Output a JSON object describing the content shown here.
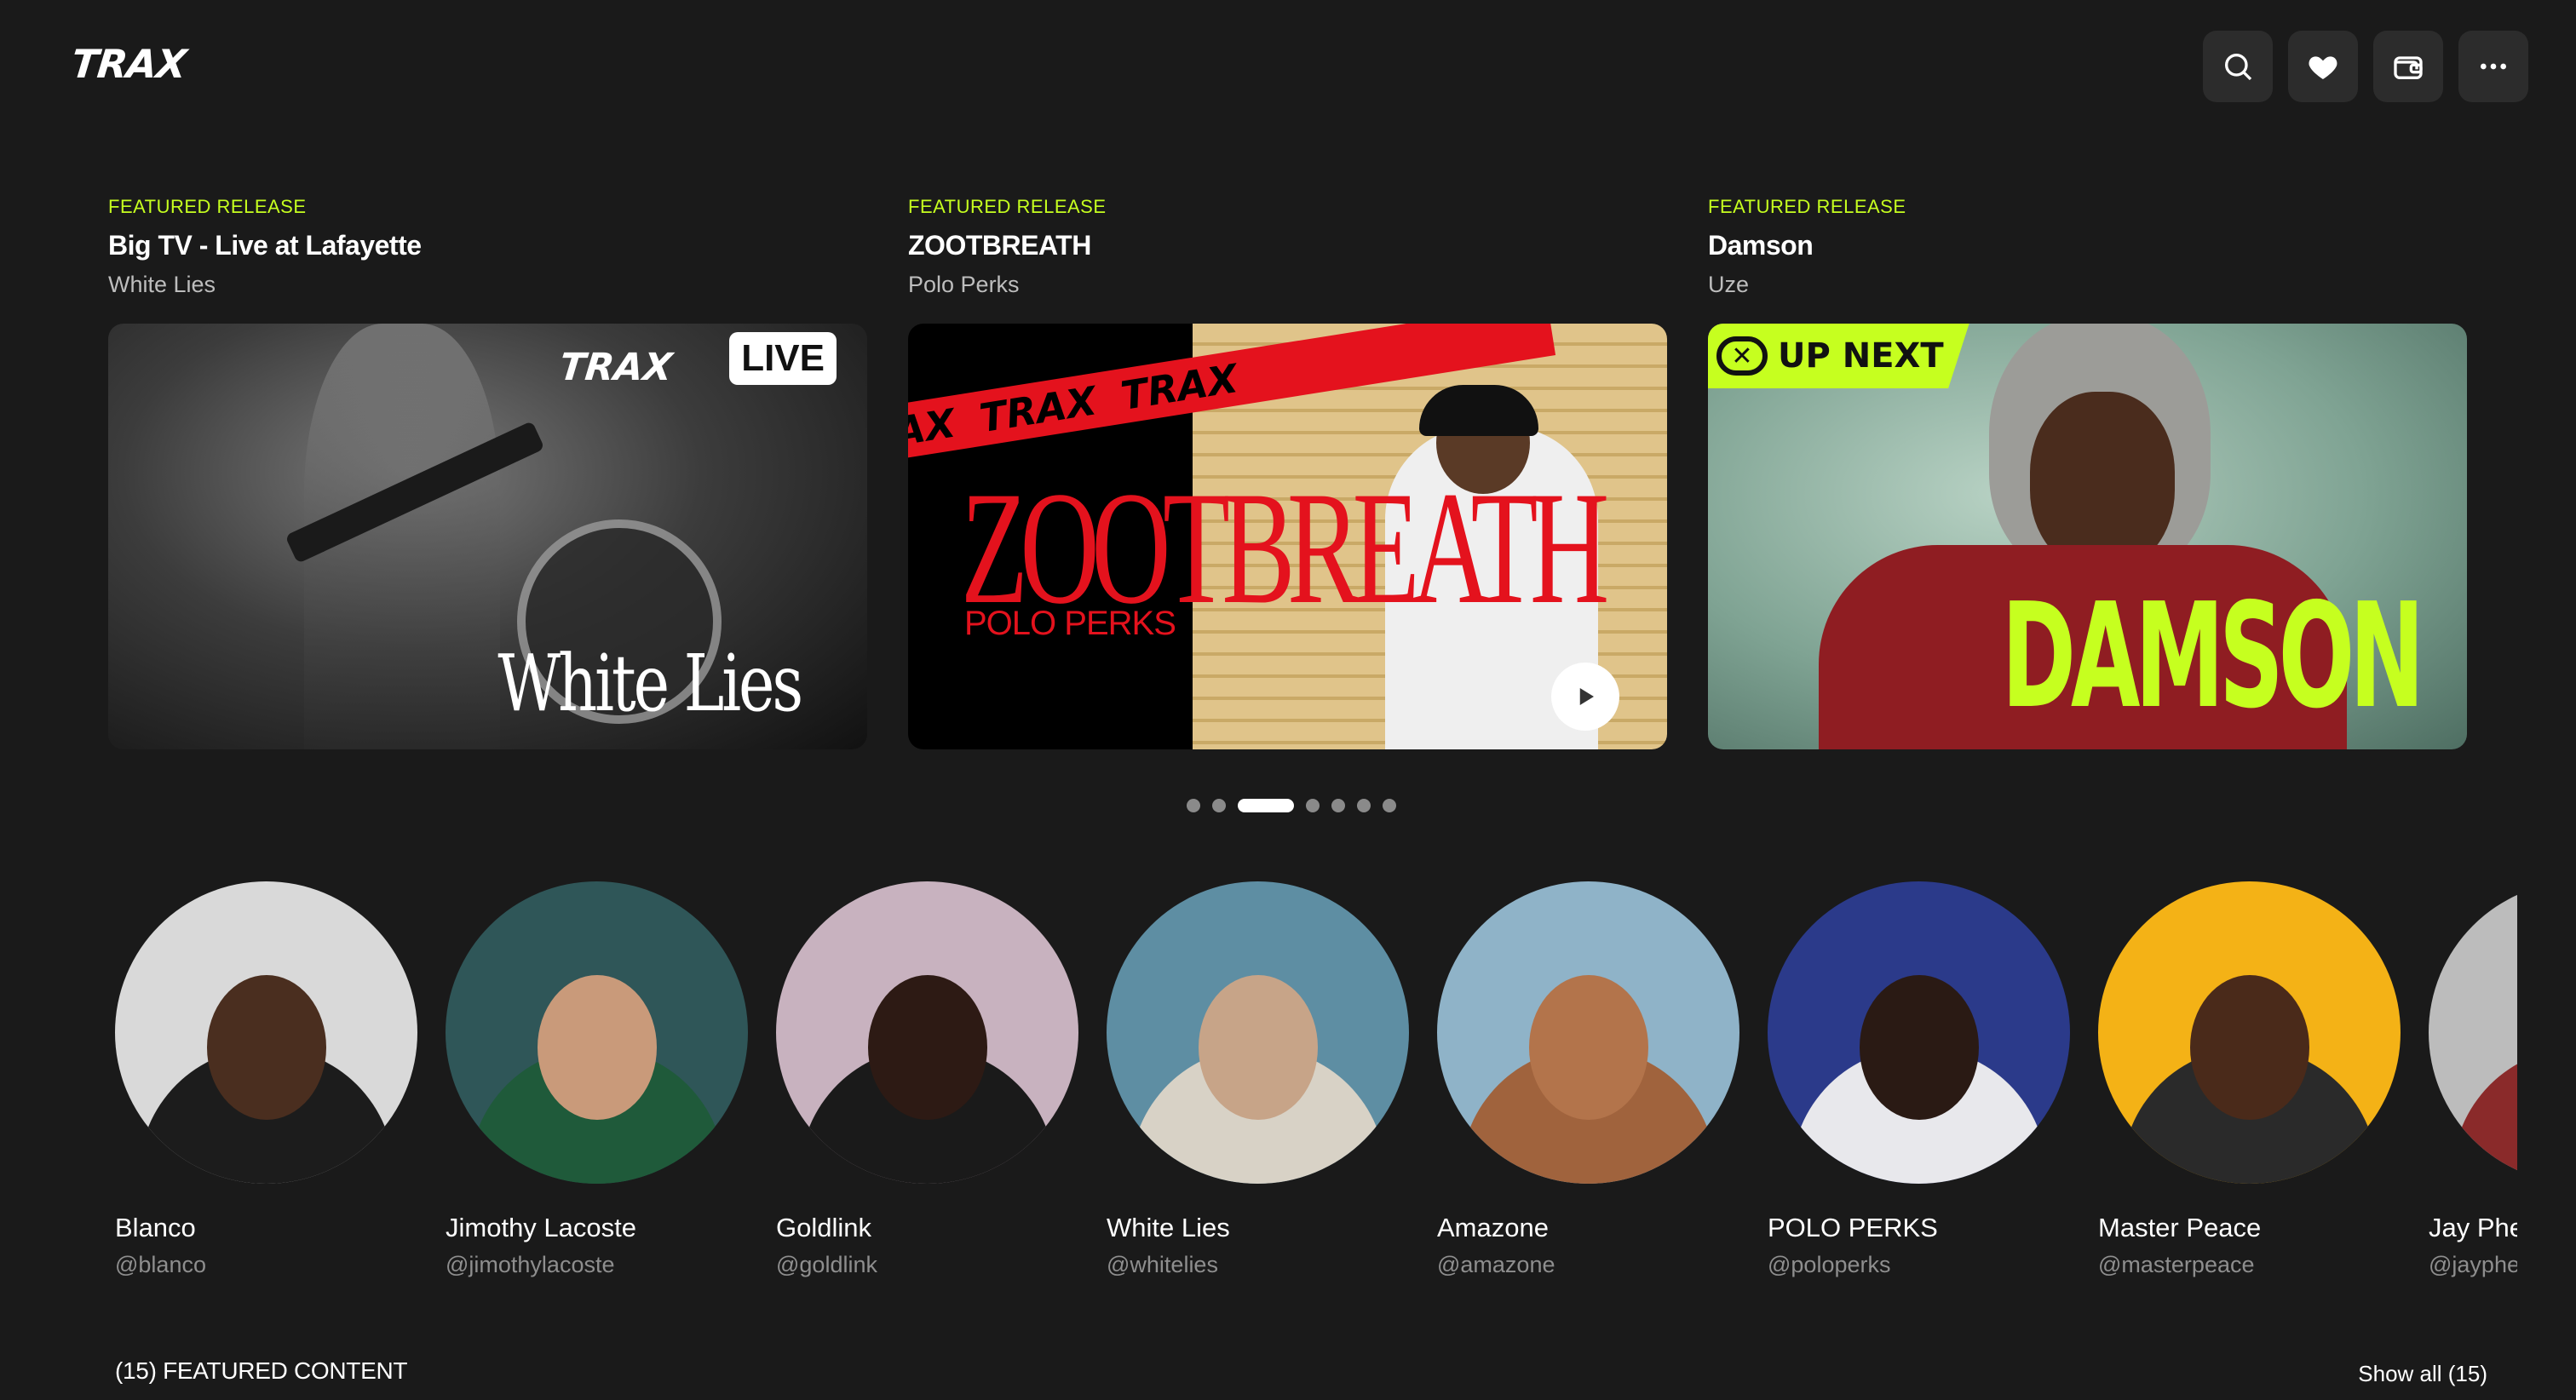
{
  "header": {
    "logo": "TRAX",
    "actions": [
      {
        "name": "search",
        "icon": "search-icon"
      },
      {
        "name": "favorites",
        "icon": "heart-icon"
      },
      {
        "name": "wallet",
        "icon": "wallet-icon"
      },
      {
        "name": "more",
        "icon": "more-icon"
      }
    ]
  },
  "featured": [
    {
      "tag": "FEATURED RELEASE",
      "title": "Big TV - Live at Lafayette",
      "artist": "White Lies",
      "art": {
        "brand": "TRAX",
        "badge": "LIVE",
        "text": "White Lies"
      }
    },
    {
      "tag": "FEATURED RELEASE",
      "title": "ZOOTBREATH",
      "artist": "Polo Perks",
      "art": {
        "band_text_1": "AX",
        "band_text_2": "TRAX",
        "band_text_3": "TRAX",
        "title": "ZOOTBREATH",
        "subtitle": "POLO PERKS",
        "play_icon": "play-icon"
      }
    },
    {
      "tag": "FEATURED RELEASE",
      "title": "Damson",
      "artist": "Uze",
      "art": {
        "badge": "UP NEXT",
        "text": "DAMSON"
      }
    }
  ],
  "carousel": {
    "dot_count": 7,
    "active_index": 2
  },
  "artists": [
    {
      "name": "Blanco",
      "handle": "@blanco",
      "bg": "#d9d9d9",
      "skin": "#4a2e1f",
      "shirt": "#1c1c1c"
    },
    {
      "name": "Jimothy Lacoste",
      "handle": "@jimothylacoste",
      "bg": "#2f5658",
      "skin": "#c99a7a",
      "shirt": "#1f5a3a"
    },
    {
      "name": "Goldlink",
      "handle": "@goldlink",
      "bg": "#c8b2bf",
      "skin": "#2d1a14",
      "shirt": "#1a1a1a"
    },
    {
      "name": "White Lies",
      "handle": "@whitelies",
      "bg": "#5e8ea3",
      "skin": "#c7a488",
      "shirt": "#d8d2c6"
    },
    {
      "name": "Amazone",
      "handle": "@amazone",
      "bg": "#8fb3c8",
      "skin": "#b3744b",
      "shirt": "#a0633d"
    },
    {
      "name": "POLO PERKS",
      "handle": "@poloperks",
      "bg": "#2b3a8a",
      "skin": "#2a1a14",
      "shirt": "#e8e8ec"
    },
    {
      "name": "Master Peace",
      "handle": "@masterpeace",
      "bg": "#f4b216",
      "skin": "#4a2a1a",
      "shirt": "#2a2a2a"
    },
    {
      "name": "Jay Phelps",
      "handle": "@jayphelps",
      "bg": "#bcbcbc",
      "skin": "#6a3a22",
      "shirt": "#8a2a2a"
    }
  ],
  "section": {
    "title": "(15) FEATURED CONTENT",
    "show_all": "Show all (15)"
  }
}
